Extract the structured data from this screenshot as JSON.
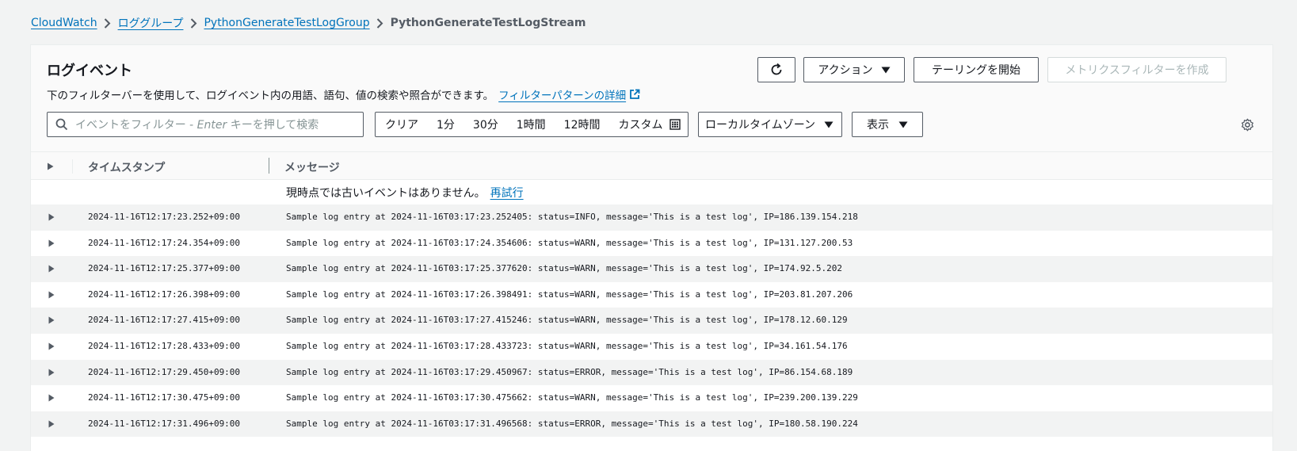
{
  "breadcrumb": {
    "items": [
      "CloudWatch",
      "ロググループ",
      "PythonGenerateTestLogGroup"
    ],
    "current": "PythonGenerateTestLogStream"
  },
  "header": {
    "title": "ログイベント",
    "description": "下のフィルターバーを使用して、ログイベント内の用語、語句、値の検索や照合ができます。",
    "detail_link": "フィルターパターンの詳細"
  },
  "toolbar": {
    "refresh_icon": "refresh-icon",
    "actions_label": "アクション",
    "start_tail_label": "テーリングを開始",
    "metric_filter_label": "メトリクスフィルターを作成"
  },
  "filter": {
    "placeholder_pre": "イベントをフィルター - ",
    "placeholder_em": "Enter",
    "placeholder_post": " キーを押して検索"
  },
  "time_range": {
    "options": [
      "クリア",
      "1分",
      "30分",
      "1時間",
      "12時間",
      "カスタム"
    ]
  },
  "timezone": {
    "selected": "ローカルタイムゾーン"
  },
  "view": {
    "label": "表示"
  },
  "table": {
    "columns": {
      "timestamp": "タイムスタンプ",
      "message": "メッセージ"
    },
    "notice_text": "現時点では古いイベントはありません。",
    "retry_label": "再試行",
    "rows": [
      {
        "timestamp": "2024-11-16T12:17:23.252+09:00",
        "message": "Sample log entry at 2024-11-16T03:17:23.252405: status=INFO, message='This is a test log', IP=186.139.154.218"
      },
      {
        "timestamp": "2024-11-16T12:17:24.354+09:00",
        "message": "Sample log entry at 2024-11-16T03:17:24.354606: status=WARN, message='This is a test log', IP=131.127.200.53"
      },
      {
        "timestamp": "2024-11-16T12:17:25.377+09:00",
        "message": "Sample log entry at 2024-11-16T03:17:25.377620: status=WARN, message='This is a test log', IP=174.92.5.202"
      },
      {
        "timestamp": "2024-11-16T12:17:26.398+09:00",
        "message": "Sample log entry at 2024-11-16T03:17:26.398491: status=WARN, message='This is a test log', IP=203.81.207.206"
      },
      {
        "timestamp": "2024-11-16T12:17:27.415+09:00",
        "message": "Sample log entry at 2024-11-16T03:17:27.415246: status=WARN, message='This is a test log', IP=178.12.60.129"
      },
      {
        "timestamp": "2024-11-16T12:17:28.433+09:00",
        "message": "Sample log entry at 2024-11-16T03:17:28.433723: status=WARN, message='This is a test log', IP=34.161.54.176"
      },
      {
        "timestamp": "2024-11-16T12:17:29.450+09:00",
        "message": "Sample log entry at 2024-11-16T03:17:29.450967: status=ERROR, message='This is a test log', IP=86.154.68.189"
      },
      {
        "timestamp": "2024-11-16T12:17:30.475+09:00",
        "message": "Sample log entry at 2024-11-16T03:17:30.475662: status=WARN, message='This is a test log', IP=239.200.139.229"
      },
      {
        "timestamp": "2024-11-16T12:17:31.496+09:00",
        "message": "Sample log entry at 2024-11-16T03:17:31.496568: status=ERROR, message='This is a test log', IP=180.58.190.224"
      }
    ]
  },
  "colors": {
    "link": "#0073bb",
    "row_alt": "#f2f3f3",
    "border": "#545b64"
  }
}
